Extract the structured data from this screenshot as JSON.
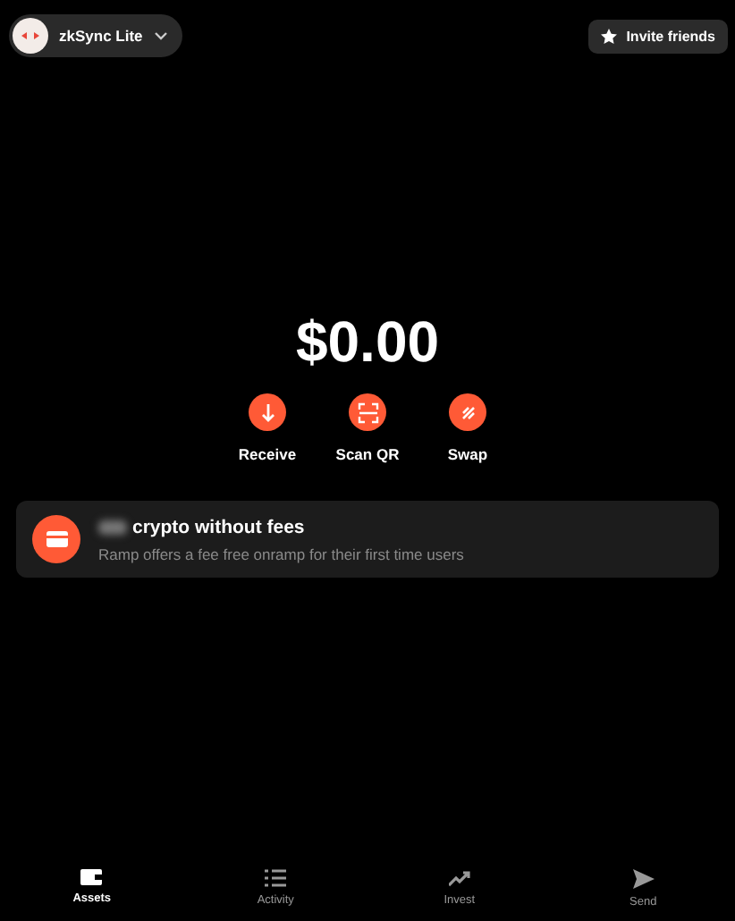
{
  "account": {
    "name": "zkSync Lite"
  },
  "invite": {
    "label": "Invite friends"
  },
  "balance": "$0.00",
  "actions": [
    {
      "kind": "receive",
      "label": "Receive"
    },
    {
      "kind": "scan",
      "label": "Scan QR"
    },
    {
      "kind": "swap",
      "label": "Swap"
    }
  ],
  "promo": {
    "title": "crypto without fees",
    "subtitle": "Ramp offers a fee free onramp for their first time users"
  },
  "nav": [
    {
      "kind": "assets",
      "label": "Assets",
      "selected": true
    },
    {
      "kind": "activity",
      "label": "Activity",
      "selected": false
    },
    {
      "kind": "invest",
      "label": "Invest",
      "selected": false
    },
    {
      "kind": "send",
      "label": "Send",
      "selected": false
    }
  ]
}
